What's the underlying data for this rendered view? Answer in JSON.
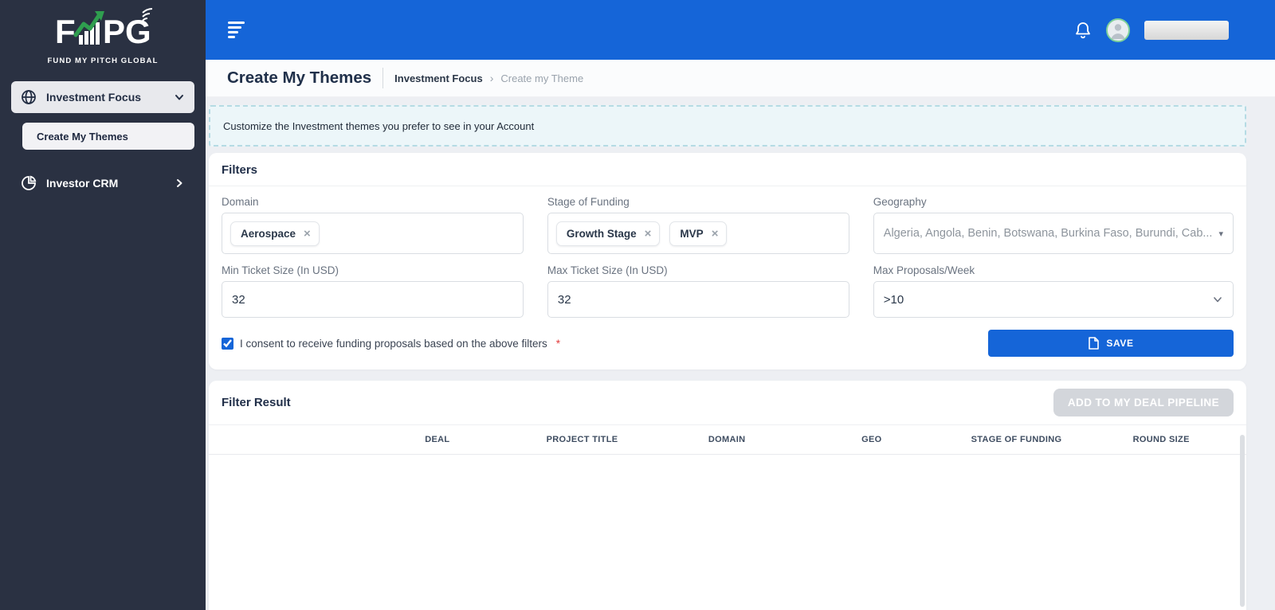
{
  "colors": {
    "sidebar_bg": "#2a3142",
    "topbar_blue": "#1565d8",
    "accent_blue": "#1565d8",
    "logo_green": "#2f9e4f",
    "banner_bg": "#ecf6f9",
    "disabled_btn": "#d3d6db",
    "required_red": "#e23b3b"
  },
  "icons": {
    "close": "×",
    "caret_down": "▾"
  },
  "sidebar": {
    "logo_text": "FMPG",
    "logo_subtitle": "FUND MY PITCH GLOBAL",
    "items": [
      {
        "label": "Investment Focus"
      },
      {
        "label": "Create My Themes"
      },
      {
        "label": "Investor CRM"
      }
    ]
  },
  "page": {
    "title": "Create My Themes",
    "breadcrumb": {
      "parent": "Investment Focus",
      "current": "Create my Theme"
    }
  },
  "banner": {
    "text": "Customize the Investment themes you prefer to see in your Account"
  },
  "filters": {
    "title": "Filters",
    "domain": {
      "label": "Domain",
      "chips": [
        "Aerospace"
      ]
    },
    "stage": {
      "label": "Stage of Funding",
      "chips": [
        "Growth Stage",
        "MVP"
      ]
    },
    "geography": {
      "label": "Geography",
      "value": "Algeria, Angola, Benin, Botswana, Burkina Faso, Burundi, Cab..."
    },
    "min_ticket": {
      "label": "Min Ticket Size (In USD)",
      "value": "32"
    },
    "max_ticket": {
      "label": "Max Ticket Size (In USD)",
      "value": "32"
    },
    "max_proposals": {
      "label": "Max Proposals/Week",
      "value": ">10"
    },
    "consent": {
      "label": "I consent to receive funding proposals based on the above filters",
      "required_mark": "*",
      "checked": true
    },
    "save_label": "SAVE"
  },
  "results": {
    "title": "Filter Result",
    "add_button_label": "ADD TO MY DEAL PIPELINE",
    "columns": [
      "DEAL",
      "PROJECT TITLE",
      "DOMAIN",
      "GEO",
      "STAGE OF FUNDING",
      "ROUND SIZE"
    ],
    "rows": []
  }
}
